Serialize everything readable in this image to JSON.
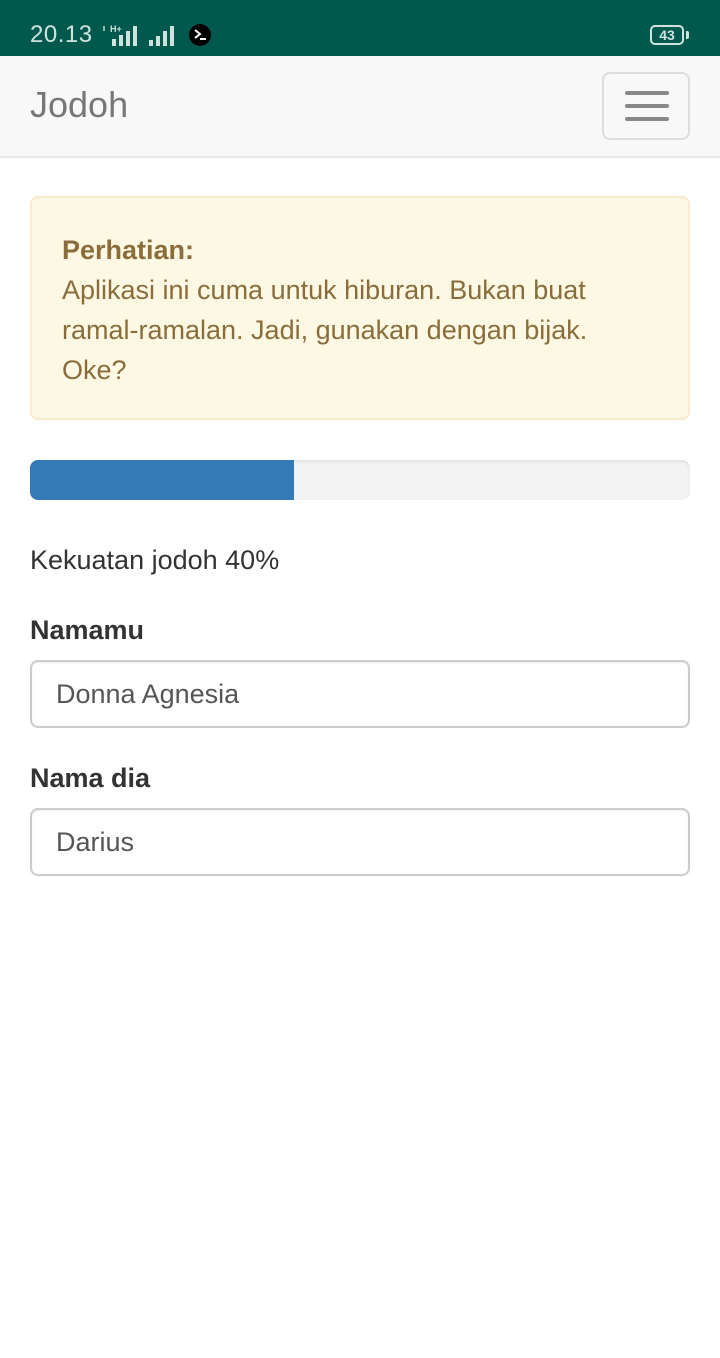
{
  "status_bar": {
    "time": "20.13",
    "network_badge": "H+",
    "battery": "43",
    "icons": [
      "signal-h-plus-icon",
      "signal-icon",
      "terminal-icon"
    ]
  },
  "navbar": {
    "brand": "Jodoh",
    "menu_icon": "hamburger-menu-icon"
  },
  "alert": {
    "title": "Perhatian:",
    "message": "Aplikasi ini cuma untuk hiburan. Bukan buat ramal-ramalan. Jadi, gunakan dengan bijak. Oke?"
  },
  "progress": {
    "value": 0.4
  },
  "strength_text": "Kekuatan jodoh 40%",
  "form": {
    "your_name_label": "Namamu",
    "your_name_value": "Donna Agnesia",
    "their_name_label": "Nama dia",
    "their_name_value": "Darius"
  },
  "colors": {
    "status_bar": "#00594c",
    "navbar_bg": "#f8f8f8",
    "alert_bg": "#fcf8e3",
    "alert_text": "#8a6d3b",
    "progress_fill": "#337ab7",
    "progress_track": "#f3f3f3"
  }
}
